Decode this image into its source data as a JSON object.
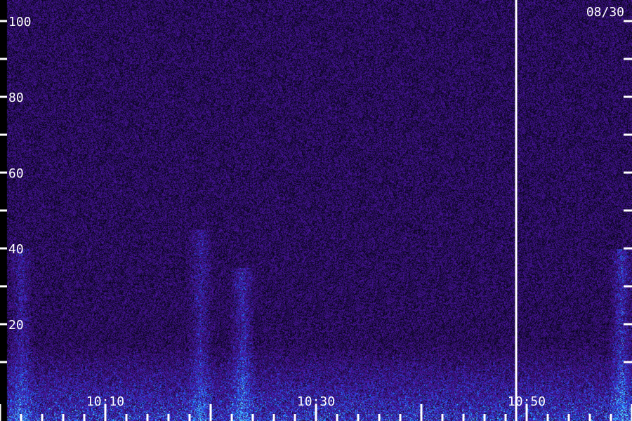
{
  "chart_data": {
    "type": "heatmap",
    "title": "",
    "date_label": "08/30",
    "xlabel": "",
    "ylabel": "",
    "ylim": [
      0,
      100
    ],
    "y_major_ticks": [
      20,
      40,
      60,
      80,
      100
    ],
    "y_minor_ticks": [
      10,
      30,
      50,
      70,
      90
    ],
    "y_tick_labels": [
      "20",
      "40",
      "60",
      "80",
      "100"
    ],
    "x_major_ticks": [
      "10:10",
      "10:30",
      "10:50"
    ],
    "x_tick_labels": [
      "10:10",
      "10:30",
      "10:50"
    ],
    "x_range_minutes": [
      "10:00",
      "11:00"
    ],
    "marker_time": "10:49",
    "colormap": [
      "#000000",
      "#1a0a4a",
      "#3a1a8a",
      "#2a40d0",
      "#2080ff",
      "#40e0ff",
      "#c0ffff",
      "#ffffff"
    ],
    "background_color": "#1c0c44",
    "noise_band_max": 15,
    "events": [
      {
        "time": "10:02",
        "intensity": 0.35,
        "top": 40
      },
      {
        "time": "10:19",
        "intensity": 0.35,
        "top": 45
      },
      {
        "time": "10:23",
        "intensity": 0.45,
        "top": 35
      },
      {
        "time": "10:59",
        "intensity": 0.5,
        "top": 40
      }
    ]
  }
}
